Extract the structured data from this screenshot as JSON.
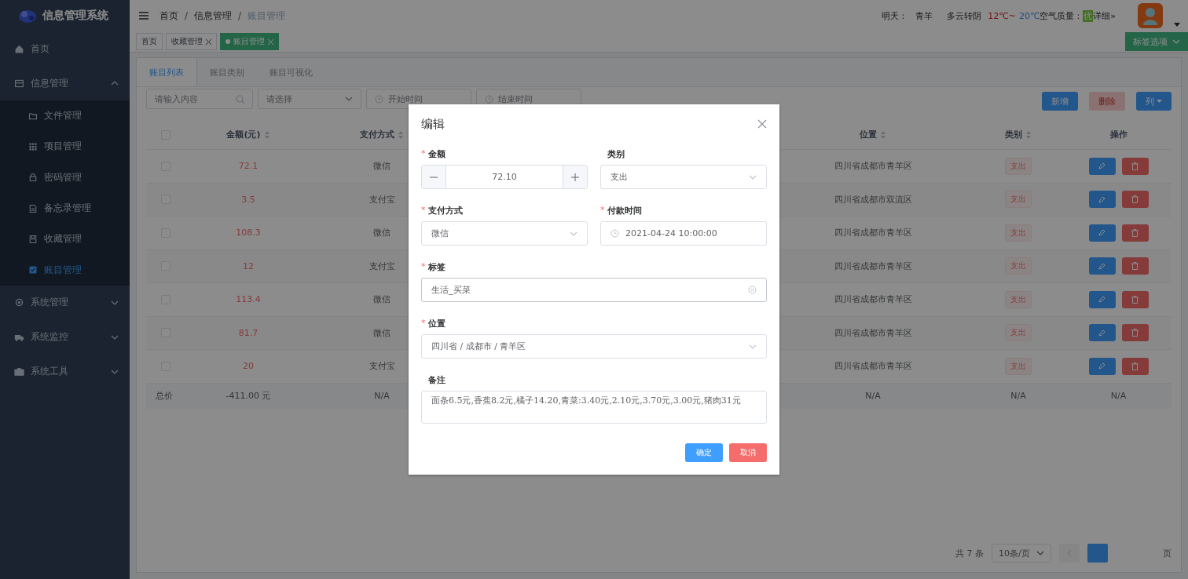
{
  "sidebar": {
    "title": "信息管理系统",
    "items": [
      {
        "kind": "link",
        "label": "首页"
      },
      {
        "kind": "group",
        "label": "信息管理",
        "expanded": true,
        "children": [
          {
            "label": "文件管理",
            "selected": false
          },
          {
            "label": "项目管理",
            "selected": false
          },
          {
            "label": "密码管理",
            "selected": false
          },
          {
            "label": "备忘录管理",
            "selected": false
          },
          {
            "label": "收藏管理",
            "selected": false
          },
          {
            "label": "账目管理",
            "selected": true
          }
        ]
      },
      {
        "kind": "group",
        "label": "系统管理",
        "expanded": false
      },
      {
        "kind": "group",
        "label": "系统监控",
        "expanded": false
      },
      {
        "kind": "group",
        "label": "系统工具",
        "expanded": false
      }
    ]
  },
  "breadcrumb": {
    "separator": "/",
    "items": [
      "首页",
      "信息管理",
      "账目管理"
    ]
  },
  "weather": {
    "label": "明天：",
    "city": "青羊",
    "condition": "多云转阴",
    "high": "12℃~",
    "low": "20℃",
    "aqi_label": "空气质量：",
    "aqi": "优",
    "more": "详细»"
  },
  "tags": [
    {
      "label": "首页",
      "closable": false,
      "selected": false
    },
    {
      "label": "收藏管理",
      "closable": true,
      "selected": false
    },
    {
      "label": "账目管理",
      "closable": true,
      "selected": true
    }
  ],
  "tag_options": "标签选项",
  "tabs": [
    {
      "label": "账目列表",
      "selected": true
    },
    {
      "label": "账目类别",
      "selected": false
    },
    {
      "label": "账目可视化",
      "selected": false
    }
  ],
  "filters": {
    "search": "请输入内容",
    "select": "请选择",
    "start": "开始时间",
    "end": "结束时间"
  },
  "actions": [
    {
      "label": "新增",
      "kind": "primary",
      "disabled": false
    },
    {
      "label": "删除",
      "kind": "danger",
      "disabled": true
    },
    {
      "label": "列",
      "kind": "dropdown",
      "disabled": false
    }
  ],
  "table": {
    "all_checked": false,
    "columns": [
      {
        "label": "金额(元)",
        "sortable": true
      },
      {
        "label": "支付方式",
        "sortable": true
      },
      {
        "label": "位置",
        "sortable": true
      },
      {
        "label": "类别",
        "sortable": true
      },
      {
        "label": "操作",
        "sortable": false
      }
    ],
    "rows": [
      {
        "checked": false,
        "amount": "72.1",
        "payment": "微信",
        "location": "四川省成都市青羊区",
        "category": "支出"
      },
      {
        "checked": false,
        "amount": "3.5",
        "payment": "支付宝",
        "location": "四川省成都市双流区",
        "category": "支出"
      },
      {
        "checked": false,
        "amount": "108.3",
        "payment": "微信",
        "location": "四川省成都市青羊区",
        "category": "支出"
      },
      {
        "checked": false,
        "amount": "12",
        "payment": "支付宝",
        "location": "四川省成都市青羊区",
        "category": "支出"
      },
      {
        "checked": false,
        "amount": "113.4",
        "payment": "微信",
        "location": "四川省成都市青羊区",
        "category": "支出"
      },
      {
        "checked": false,
        "amount": "81.7",
        "payment": "微信",
        "location": "四川省成都市青羊区",
        "category": "支出"
      },
      {
        "checked": false,
        "amount": "20",
        "payment": "支付宝",
        "location": "四川省成都市青羊区",
        "category": "支出"
      }
    ],
    "summary": [
      "总价",
      "-411.00 元",
      "N/A",
      "N/A",
      "N/A",
      "N/A"
    ]
  },
  "pagination": {
    "total": "共 7 条",
    "page_size": "10条/页",
    "suffix": "页"
  },
  "dialog": {
    "title": "编辑",
    "required_mark": "*",
    "fields": [
      {
        "kind": "number",
        "label": "金额",
        "required": true,
        "value": "72.10"
      },
      {
        "kind": "select",
        "label": "类别",
        "required": false,
        "value": "支出"
      },
      {
        "kind": "select",
        "label": "支付方式",
        "required": true,
        "value": "微信"
      },
      {
        "kind": "date",
        "label": "付款时间",
        "required": true,
        "value": "2021-04-24 10:00:00"
      },
      {
        "kind": "clearable",
        "label": "标签",
        "required": true,
        "value": "生活_买菜"
      },
      {
        "kind": "select",
        "label": "位置",
        "required": true,
        "value": "四川省 / 成都市 / 青羊区"
      },
      {
        "kind": "textarea",
        "label": "备注",
        "required": false,
        "value": "面条6.5元,香蕉8.2元,橘子14.20,青菜:3.40元,2.10元,3.70元,3.00元,猪肉31元"
      }
    ],
    "buttons": [
      {
        "label": "确定",
        "kind": "primary"
      },
      {
        "label": "取消",
        "kind": "danger"
      }
    ]
  }
}
